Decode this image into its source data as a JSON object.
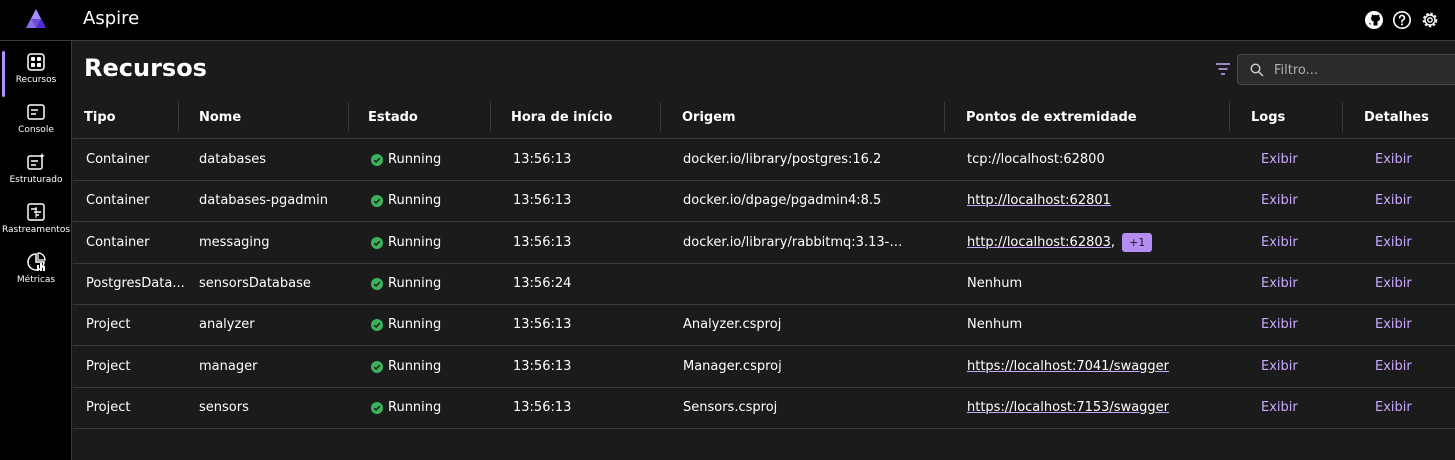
{
  "app": {
    "title": "Aspire"
  },
  "nav": {
    "items": [
      {
        "label": "Recursos",
        "icon": "resources-grid-icon"
      },
      {
        "label": "Console",
        "icon": "console-icon"
      },
      {
        "label": "Estruturado",
        "icon": "structured-logs-icon"
      },
      {
        "label": "Rastreamentos",
        "icon": "traces-icon"
      },
      {
        "label": "Métricas",
        "icon": "metrics-icon"
      }
    ]
  },
  "page": {
    "title": "Recursos"
  },
  "search": {
    "placeholder": "Filtro..."
  },
  "table": {
    "headers": {
      "type": "Tipo",
      "name": "Nome",
      "state": "Estado",
      "start": "Hora de início",
      "source": "Origem",
      "endpoints": "Pontos de extremidade",
      "logs": "Logs",
      "details": "Detalhes"
    },
    "rows": [
      {
        "type": "Container",
        "name": "databases",
        "state": "Running",
        "start": "13:56:13",
        "source": "docker.io/library/postgres:16.2",
        "endpoint": "tcp://localhost:62800",
        "logs": "Exibir",
        "details": "Exibir"
      },
      {
        "type": "Container",
        "name": "databases-pgadmin",
        "state": "Running",
        "start": "13:56:13",
        "source": "docker.io/dpage/pgadmin4:8.5",
        "endpoint": "http://localhost:62801",
        "logs": "Exibir",
        "details": "Exibir"
      },
      {
        "type": "Container",
        "name": "messaging",
        "state": "Running",
        "start": "13:56:13",
        "source": "docker.io/library/rabbitmq:3.13-mana...",
        "endpoint": "http://localhost:62803",
        "extra": "+1",
        "logs": "Exibir",
        "details": "Exibir"
      },
      {
        "type": "PostgresData...",
        "name": "sensorsDatabase",
        "state": "Running",
        "start": "13:56:24",
        "source": "",
        "endpoint": "Nenhum",
        "logs": "Exibir",
        "details": "Exibir"
      },
      {
        "type": "Project",
        "name": "analyzer",
        "state": "Running",
        "start": "13:56:13",
        "source": "Analyzer.csproj",
        "endpoint": "Nenhum",
        "logs": "Exibir",
        "details": "Exibir"
      },
      {
        "type": "Project",
        "name": "manager",
        "state": "Running",
        "start": "13:56:13",
        "source": "Manager.csproj",
        "endpoint": "https://localhost:7041/swagger",
        "logs": "Exibir",
        "details": "Exibir"
      },
      {
        "type": "Project",
        "name": "sensors",
        "state": "Running",
        "start": "13:56:13",
        "source": "Sensors.csproj",
        "endpoint": "https://localhost:7153/swagger",
        "logs": "Exibir",
        "details": "Exibir"
      }
    ]
  },
  "colors": {
    "accent": "#b290f5",
    "running": "#3cb35a",
    "background": "#1b1b1b",
    "chrome": "#000000"
  }
}
